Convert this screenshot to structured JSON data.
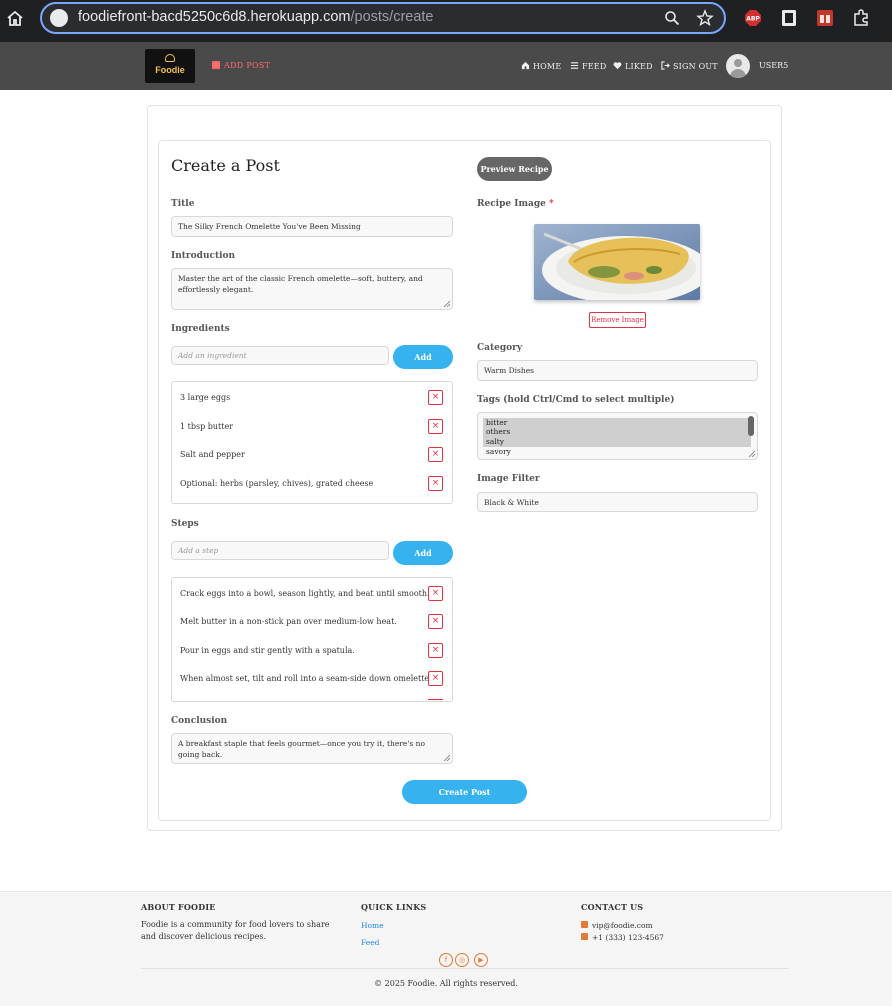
{
  "browser": {
    "url_host": "foodiefront-bacd5250c6d8.herokuapp.com",
    "url_path": "/posts/create",
    "extensions": [
      "ABP"
    ]
  },
  "navbar": {
    "logo_text": "Foodie",
    "add_post": "ADD POST",
    "links": [
      "HOME",
      "FEED",
      "LIKED",
      "SIGN OUT"
    ],
    "username": "USER5"
  },
  "form": {
    "title": "Create a Post",
    "preview_label": "Preview Recipe",
    "title_label": "Title",
    "title_value": "The Silky French Omelette You've Been Missing",
    "intro_label": "Introduction",
    "intro_value": "Master the art of the classic French omelette—soft, buttery, and effortlessly elegant.",
    "ingredients_label": "Ingredients",
    "ingredient_placeholder": "Add an ingredient",
    "add_label": "Add",
    "ingredients": [
      "3 large eggs",
      "1 tbsp butter",
      "Salt and pepper",
      "Optional: herbs (parsley, chives), grated cheese"
    ],
    "steps_label": "Steps",
    "step_placeholder": "Add a step",
    "steps": [
      "Crack eggs into a bowl, season lightly, and beat until smooth.",
      "Melt butter in a non-stick pan over medium-low heat.",
      "Pour in eggs and stir gently with a spatula.",
      "When almost set, tilt and roll into a seam-side down omelette."
    ],
    "conclusion_label": "Conclusion",
    "conclusion_value": "A breakfast staple that feels gourmet—once you try it, there's no going back.",
    "image_label": "Recipe Image",
    "required_mark": "*",
    "remove_image_label": "Remove Image",
    "category_label": "Category",
    "category_value": "Warm Dishes",
    "tags_label": "Tags (hold Ctrl/Cmd to select multiple)",
    "tags": [
      {
        "name": "bitter",
        "selected": true
      },
      {
        "name": "others",
        "selected": true
      },
      {
        "name": "salty",
        "selected": true
      },
      {
        "name": "savory",
        "selected": false
      },
      {
        "name": "sour",
        "selected": false
      }
    ],
    "filter_label": "Image Filter",
    "filter_value": "Black & White",
    "create_label": "Create Post"
  },
  "footer": {
    "about_heading": "ABOUT FOODIE",
    "about_text": "Foodie is a community for food lovers to share and discover delicious recipes.",
    "links_heading": "QUICK LINKS",
    "links": [
      "Home",
      "Feed"
    ],
    "contact_heading": "CONTACT US",
    "email": "vip@foodie.com",
    "phone": "+1 (333) 123-4567",
    "copyright": "© 2025 Foodie. All rights reserved."
  },
  "colors": {
    "accent_blue": "#36b3ee",
    "danger_red": "#dc3545",
    "navbar": "#4a4a4a",
    "footer_icon": "#e07b39"
  }
}
